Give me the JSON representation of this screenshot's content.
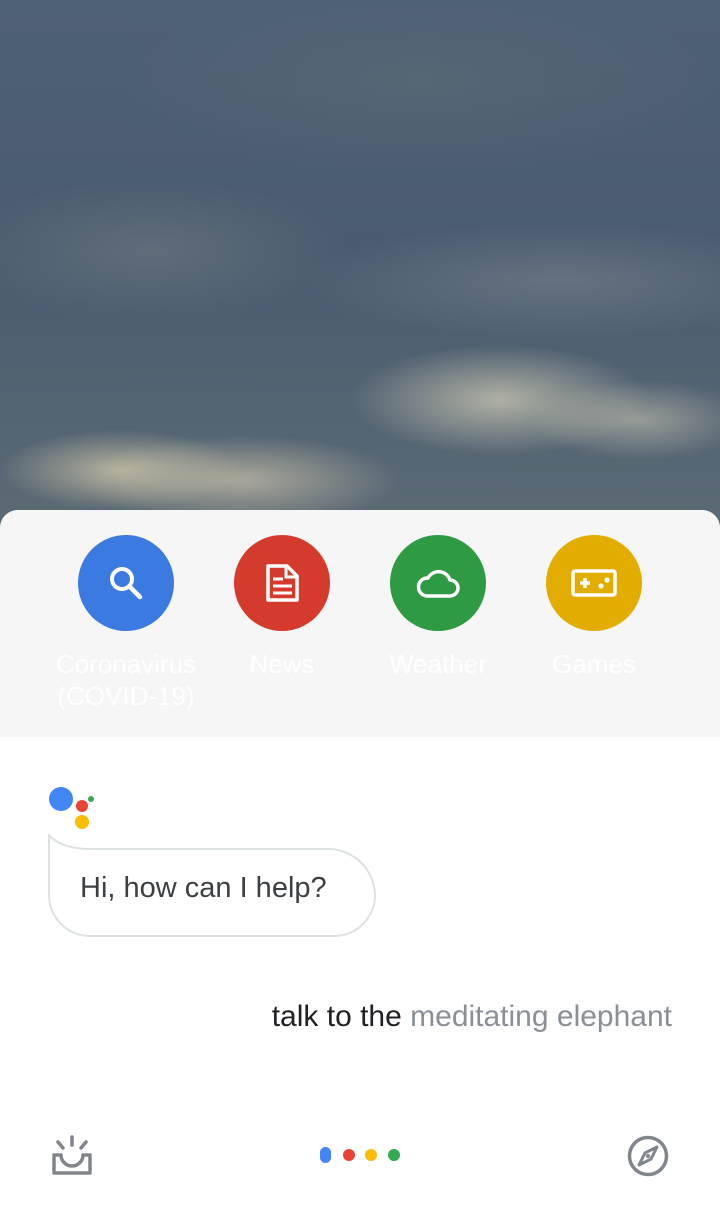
{
  "suggestions": [
    {
      "label": "Coronavirus\n(COVID-19)",
      "icon": "search-icon",
      "color": "#3b7ae0"
    },
    {
      "label": "News",
      "icon": "news-icon",
      "color": "#d53b2c"
    },
    {
      "label": "Weather",
      "icon": "cloud-icon",
      "color": "#2e9a43"
    },
    {
      "label": "Games",
      "icon": "gamepad-icon",
      "color": "#e3ad00"
    }
  ],
  "assistant": {
    "greeting": "Hi, how can I help?"
  },
  "query": {
    "final_text": "talk to the",
    "partial_text": "meditating elephant"
  },
  "bottom_bar": {
    "left_icon": "snapshot-icon",
    "center_icon": "assistant-dots-icon",
    "right_icon": "explore-compass-icon"
  },
  "colors": {
    "blue": "#4285f4",
    "red": "#ea4335",
    "yellow": "#fbbc05",
    "green": "#34a853",
    "icon_gray": "#80868b"
  }
}
